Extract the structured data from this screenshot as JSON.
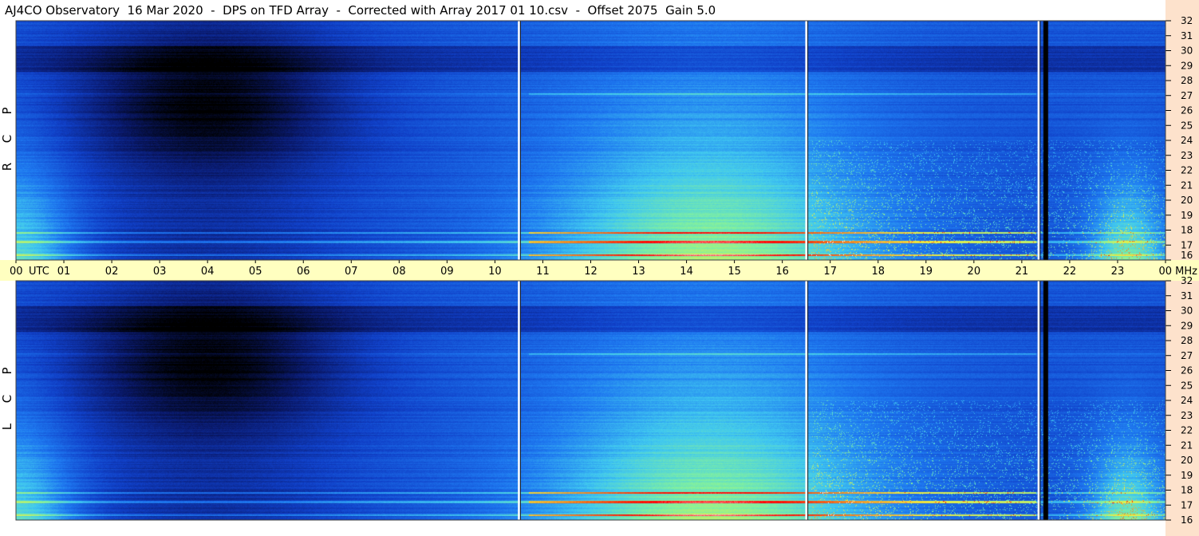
{
  "title": "AJ4CO Observatory  16 Mar 2020  -  DPS on TFD Array  -  Corrected with Array 2017 01 10.csv  -  Offset 2075  Gain 5.0",
  "chart_data": {
    "type": "heatmap",
    "panels": [
      {
        "name": "RCP",
        "side_label": [
          "R",
          "C",
          "P"
        ]
      },
      {
        "name": "LCP",
        "side_label": [
          "L",
          "C",
          "P"
        ]
      }
    ],
    "time_axis": {
      "label": "UTC",
      "tick_labels": [
        "00",
        "01",
        "02",
        "03",
        "04",
        "05",
        "06",
        "07",
        "08",
        "09",
        "10",
        "11",
        "12",
        "13",
        "14",
        "15",
        "16",
        "17",
        "18",
        "19",
        "20",
        "21",
        "22",
        "23",
        "00"
      ],
      "range_hours": [
        0,
        24
      ]
    },
    "freq_axis": {
      "label": "MHz",
      "tick_labels": [
        "32",
        "31",
        "30",
        "29",
        "28",
        "27",
        "26",
        "25",
        "24",
        "23",
        "22",
        "21",
        "20",
        "19",
        "18",
        "17",
        "16"
      ],
      "range_mhz": [
        16,
        32
      ]
    },
    "marker_lines_hours": [
      10.5,
      16.5,
      21.35
    ],
    "dark_band_hours": [
      21.45,
      21.55
    ],
    "colormap": [
      "#000000",
      "#0a1a6e",
      "#1040c8",
      "#1e78f0",
      "#40c8f0",
      "#80f0a0",
      "#f0f040",
      "#f08020",
      "#ff0000",
      "#ffffff"
    ]
  }
}
